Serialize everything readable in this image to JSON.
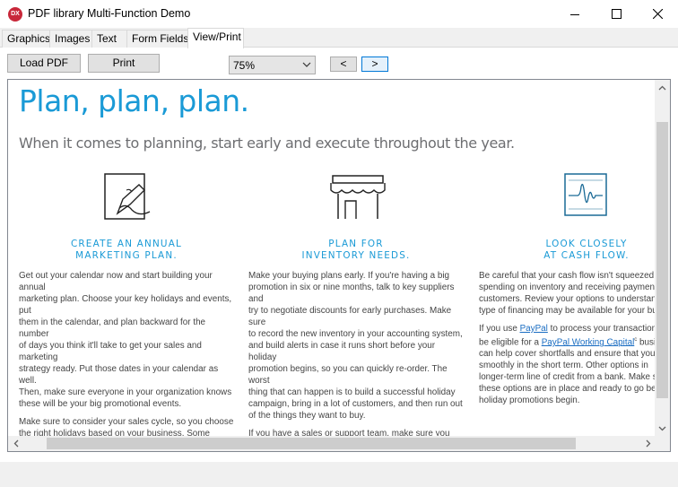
{
  "window": {
    "icon_text": "DX",
    "title": "PDF library Multi-Function Demo",
    "controls": [
      "minimize-icon",
      "maximize-icon",
      "close-icon"
    ]
  },
  "tabs": [
    {
      "label": "Graphics",
      "active": false
    },
    {
      "label": "Images",
      "active": false
    },
    {
      "label": "Text",
      "active": false
    },
    {
      "label": "Form Fields",
      "active": false
    },
    {
      "label": "View/Print",
      "active": true
    }
  ],
  "toolbar": {
    "load_label": "Load PDF",
    "print_label": "Print",
    "zoom_value": "75%",
    "prev_label": "<",
    "next_label": ">"
  },
  "document": {
    "title": "Plan, plan, plan.",
    "subtitle": "When it comes to planning, start early and execute throughout the year.",
    "accent_color": "#1a9ad6",
    "columns": [
      {
        "icon": "hand-writing-icon",
        "heading": "CREATE AN ANNUAL\nMARKETING PLAN.",
        "paragraphs": [
          "Get out your calendar now and start building your annual\nmarketing plan. Choose your key holidays and events, put\nthem in the calendar, and plan backward for the number\nof days you think it'll take to get your sales and marketing\nstrategy ready. Put those dates in your calendar as well.\nThen, make sure everyone in your organization knows\nthese will be your big promotional events.",
          "Make sure to consider your sales cycle, so you choose\nthe right holidays based on your business. Some\ncompanies traditionally introduce new products in\nthe fall, while others are very Christmas-oriented. Still\nothers have very busy summer seasons. Time your\nholiday sales pushes accordingly."
        ]
      },
      {
        "icon": "storefront-icon",
        "heading": "PLAN FOR\nINVENTORY NEEDS.",
        "paragraphs": [
          "Make your buying plans early. If you're having a big\npromotion in six or nine months, talk to key suppliers and\ntry to negotiate discounts for early purchases. Make sure\nto record the new inventory in your accounting system,\nand build alerts in case it runs short before your holiday\npromotion begins, so you can quickly re-order. The worst\nthing that can happen is to build a successful holiday\ncampaign, bring in a lot of customers, and then run out\nof the things they want to buy.",
          "If you have a sales or support team, make sure you also\nplan for staffing needs well in advance. Take the time\nto make sure they're knowledgeable about the holiday\nand how it ties into your business and your campaign.\nThen, make sure they're ready to go when your holiday"
        ]
      },
      {
        "icon": "cash-flow-chart-icon",
        "heading": "LOOK CLOSELY\nAT CASH FLOW.",
        "paragraph1": "Be careful that your cash flow isn't squeezed b\nspending on inventory and receiving payment\ncustomers. Review your options to understand\ntype of financing may be available for your bus",
        "p2_a": "If you use ",
        "p2_link1": "PayPal",
        "p2_b": " to process your transactions,\nbe eligible for a ",
        "p2_link2": "PayPal Working Capital",
        "p2_sup": "c",
        "p2_c": " busine\ncan help cover shortfalls and ensure that you'r\nsmoothly in the short term. Other options in\nlonger-term line of credit from a bank. Make s\nthese options are in place and ready to go befo\nholiday promotions begin."
      }
    ]
  }
}
